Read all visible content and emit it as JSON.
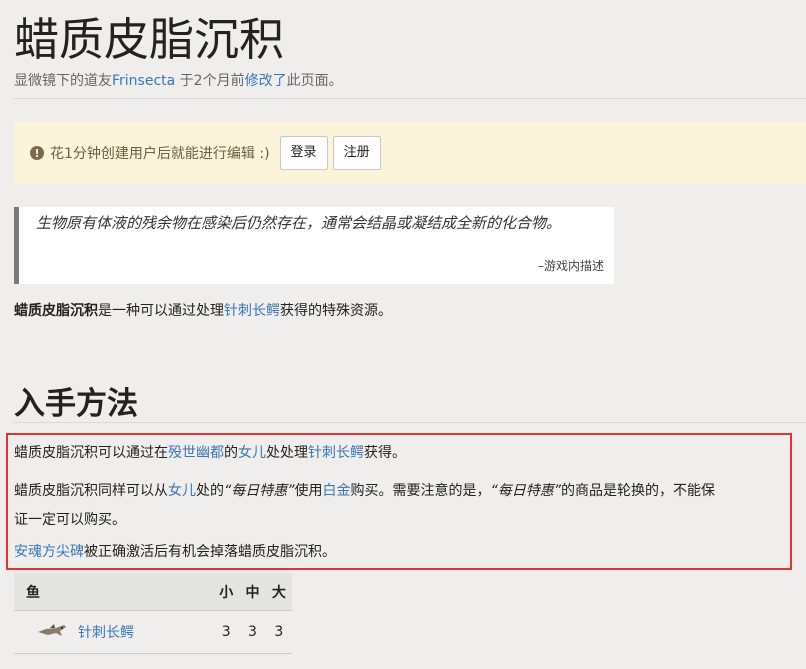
{
  "page": {
    "title": "蜡质皮脂沉积",
    "meta": {
      "prefix": "显微镜下的道友",
      "user": "Frinsecta",
      "middle": " 于2个月前",
      "edited": "修改了",
      "suffix": "此页面。"
    }
  },
  "notice": {
    "text": "花1分钟创建用户后就能进行编辑 :)",
    "login": "登录",
    "register": "注册"
  },
  "quote": {
    "text": "生物原有体液的残余物在感染后仍然存在，通常会结晶或凝结成全新的化合物。",
    "source": "–游戏内描述"
  },
  "intro": {
    "bold": "蜡质皮脂沉积",
    "a": "是一种可以通过处理",
    "link": "针刺长鳄",
    "b": "获得的特殊资源。"
  },
  "section": {
    "heading": "入手方法",
    "p1": {
      "a": "蜡质皮脂沉积可以通过在",
      "l1": "殁世幽都",
      "b": "的",
      "l2": "女儿",
      "c": "处处理",
      "l3": "针刺长鳄",
      "d": "获得。"
    },
    "p2": {
      "a": "蜡质皮脂沉积同样可以从",
      "l1": "女儿",
      "b": "处的",
      "it1": "“每日特惠”",
      "c": "使用",
      "l2": "白金",
      "d": "购买。需要注意的是，",
      "it2": "“每日特惠”",
      "e": "的商品是轮换的，不能保",
      "f": "证一定可以购买。"
    },
    "p3": {
      "link": "安魂方尖碑",
      "a": "被正确激活后有机会掉落蜡质皮脂沉积。"
    }
  },
  "table": {
    "headers": [
      "鱼",
      "小",
      "中",
      "大"
    ],
    "row": {
      "icon": "fish-icon",
      "name": "针刺长鳄",
      "small": "3",
      "medium": "3",
      "large": "3"
    }
  },
  "colors": {
    "link": "#3a76b8",
    "notice_bg": "#fbf3da",
    "highlight": "#e03333"
  }
}
